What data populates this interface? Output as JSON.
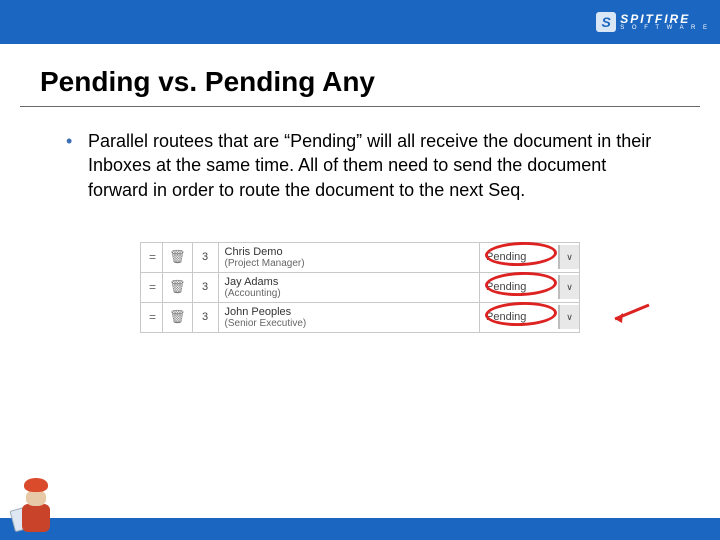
{
  "brand": {
    "badge": "S",
    "name": "SPITFIRE",
    "sub": "S O F T W A R E"
  },
  "title": "Pending vs. Pending Any",
  "bullet": "Parallel routees that are “Pending” will all receive the document in their Inboxes at the same time. All of them need to send the document forward in order to route the document to the next Seq.",
  "rows": [
    {
      "seq": "3",
      "name": "Chris Demo",
      "role": "(Project Manager)",
      "status": "Pending"
    },
    {
      "seq": "3",
      "name": "Jay Adams",
      "role": "(Accounting)",
      "status": "Pending"
    },
    {
      "seq": "3",
      "name": "John Peoples",
      "role": "(Senior Executive)",
      "status": "Pending"
    }
  ]
}
